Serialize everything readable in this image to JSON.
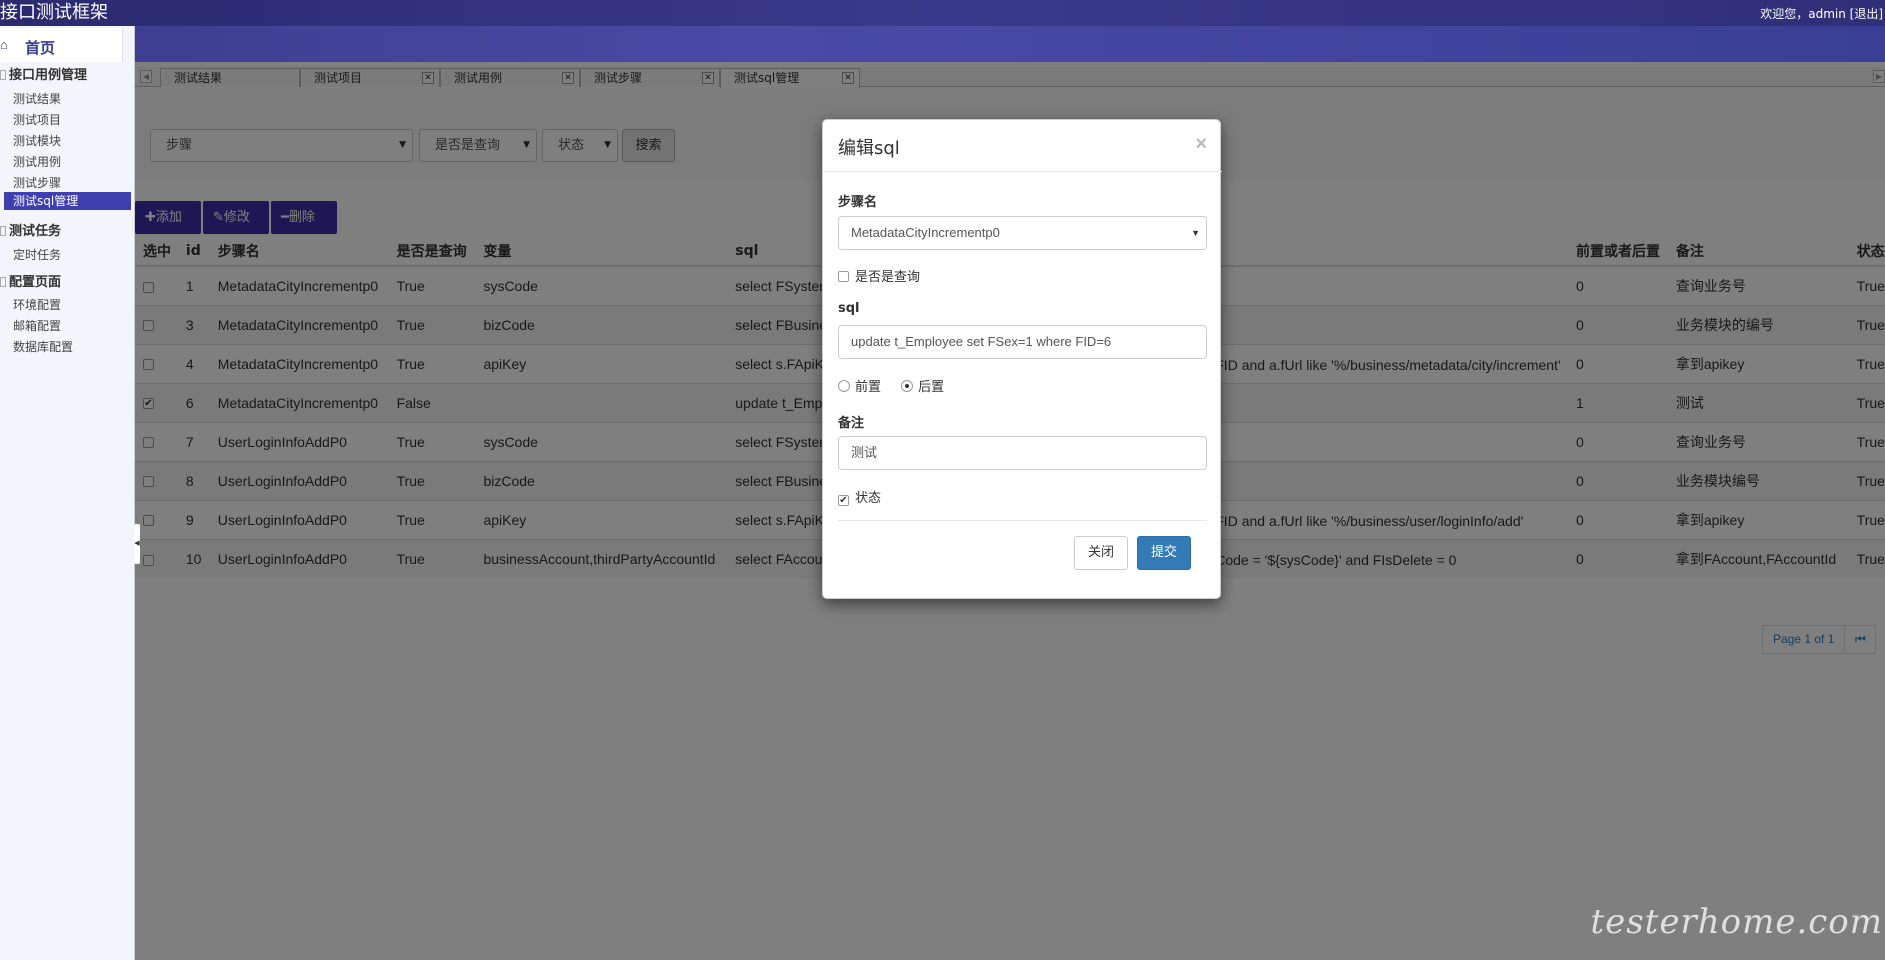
{
  "header": {
    "title": "接口测试框架",
    "welcome": "欢迎您，admin [退出]"
  },
  "sidebar": {
    "home_label": "首页",
    "groups": [
      {
        "title": "接口用例管理",
        "items": [
          "测试结果",
          "测试项目",
          "测试模块",
          "测试用例",
          "测试步骤",
          "测试sql管理"
        ]
      },
      {
        "title": "测试任务",
        "items": [
          "定时任务"
        ]
      },
      {
        "title": "配置页面",
        "items": [
          "环境配置",
          "邮箱配置",
          "数据库配置"
        ]
      }
    ]
  },
  "tabs": [
    {
      "label": "测试结果"
    },
    {
      "label": "测试项目"
    },
    {
      "label": "测试用例"
    },
    {
      "label": "测试步骤"
    },
    {
      "label": "测试sql管理"
    }
  ],
  "search": {
    "step_placeholder": "步骤",
    "is_query_placeholder": "是否是查询",
    "status_placeholder": "状态",
    "search_button": "搜索"
  },
  "toolbar": {
    "add": "添加",
    "edit": "修改",
    "delete": "删除"
  },
  "table": {
    "headers": [
      "选中",
      "id",
      "步骤名",
      "是否是查询",
      "变量",
      "sql",
      "前置或者后置",
      "备注",
      "状态"
    ],
    "rows": [
      {
        "checked": false,
        "id": "1",
        "step": "MetadataCityIncrementp0",
        "is_query": "True",
        "var": "sysCode",
        "sql": "select FSyster",
        "sql_tail": "",
        "pre_post": "0",
        "remark": "查询业务号",
        "status": "True"
      },
      {
        "checked": false,
        "id": "3",
        "step": "MetadataCityIncrementp0",
        "is_query": "True",
        "var": "bizCode",
        "sql": "select FBusine",
        "sql_tail": "",
        "pre_post": "0",
        "remark": "业务模块的编号",
        "status": "True"
      },
      {
        "checked": false,
        "id": "4",
        "step": "MetadataCityIncrementp0",
        "is_query": "True",
        "var": "apiKey",
        "sql": "select s.FApiK",
        "sql_tail": "FID and a.fUrl like '%/business/metadata/city/increment'",
        "pre_post": "0",
        "remark": "拿到apikey",
        "status": "True"
      },
      {
        "checked": true,
        "id": "6",
        "step": "MetadataCityIncrementp0",
        "is_query": "False",
        "var": "",
        "sql": "update t_Emp",
        "sql_tail": "",
        "pre_post": "1",
        "remark": "测试",
        "status": "True"
      },
      {
        "checked": false,
        "id": "7",
        "step": "UserLoginInfoAddP0",
        "is_query": "True",
        "var": "sysCode",
        "sql": "select FSyster",
        "sql_tail": "",
        "pre_post": "0",
        "remark": "查询业务号",
        "status": "True"
      },
      {
        "checked": false,
        "id": "8",
        "step": "UserLoginInfoAddP0",
        "is_query": "True",
        "var": "bizCode",
        "sql": "select FBusine",
        "sql_tail": "",
        "pre_post": "0",
        "remark": "业务模块编号",
        "status": "True"
      },
      {
        "checked": false,
        "id": "9",
        "step": "UserLoginInfoAddP0",
        "is_query": "True",
        "var": "apiKey",
        "sql": "select s.FApiK",
        "sql_tail": "FID and a.fUrl like '%/business/user/loginInfo/add'",
        "pre_post": "0",
        "remark": "拿到apikey",
        "status": "True"
      },
      {
        "checked": false,
        "id": "10",
        "step": "UserLoginInfoAddP0",
        "is_query": "True",
        "var": "businessAccount,thirdPartyAccountId",
        "sql": "select FAccou",
        "sql_tail": "Code = '${sysCode}' and FIsDelete = 0",
        "pre_post": "0",
        "remark": "拿到FAccount,FAccountId",
        "status": "True"
      }
    ]
  },
  "pager": {
    "label": "Page 1 of 1"
  },
  "modal": {
    "title": "编辑sql",
    "step_label": "步骤名",
    "step_value": "MetadataCityIncrementp0",
    "is_query_label": "是否是查询",
    "sql_label": "sql",
    "sql_value": "update t_Employee set FSex=1 where FID=6",
    "pre_label": "前置",
    "post_label": "后置",
    "remark_label": "备注",
    "remark_value": "测试",
    "status_label": "状态",
    "close_button": "关闭",
    "submit_button": "提交"
  },
  "watermark": "testerhome.com",
  "colors": {
    "header": "#2a2a6e",
    "accent": "#3a2fa6",
    "primary": "#337ab7"
  }
}
